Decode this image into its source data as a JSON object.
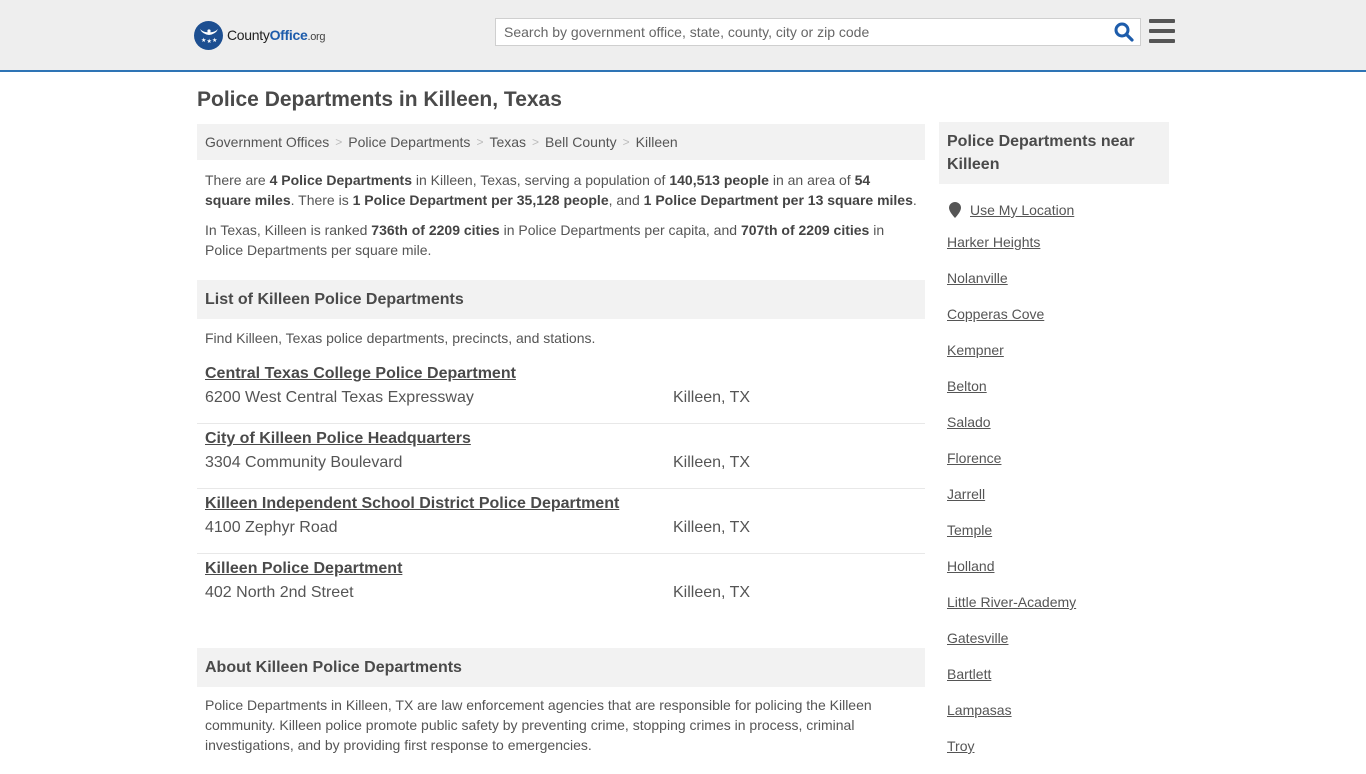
{
  "header": {
    "logo": {
      "name_main": "County",
      "name_accent": "Office",
      "name_tld": ".org"
    },
    "search": {
      "placeholder": "Search by government office, state, county, city or zip code",
      "value": ""
    },
    "icons": {
      "search": "search-icon",
      "menu": "hamburger-menu-icon"
    },
    "colors": {
      "accent": "#2e74b5",
      "logo_blue": "#1d4f91"
    }
  },
  "page": {
    "title": "Police Departments in Killeen, Texas"
  },
  "breadcrumb": [
    {
      "label": "Government Offices"
    },
    {
      "label": "Police Departments"
    },
    {
      "label": "Texas"
    },
    {
      "label": "Bell County"
    },
    {
      "label": "Killeen"
    }
  ],
  "summary": {
    "p1": {
      "t1": "There are ",
      "b1": "4 Police Departments",
      "t2": " in Killeen, Texas, serving a population of ",
      "b2": "140,513 people",
      "t3": " in an area of ",
      "b3": "54 square miles",
      "t4": ". There is ",
      "b4": "1 Police Department per 35,128 people",
      "t5": ", and ",
      "b5": "1 Police Department per 13 square miles",
      "t6": "."
    },
    "p2": {
      "t1": "In Texas, Killeen is ranked ",
      "b1": "736th of 2209 cities",
      "t2": " in Police Departments per capita, and ",
      "b2": "707th of 2209 cities",
      "t3": " in Police Departments per square mile."
    }
  },
  "list_section": {
    "heading": "List of Killeen Police Departments",
    "intro": "Find Killeen, Texas police departments, precincts, and stations.",
    "items": [
      {
        "name": "Central Texas College Police Department",
        "address": "6200 West Central Texas Expressway",
        "city": "Killeen, TX"
      },
      {
        "name": "City of Killeen Police Headquarters",
        "address": "3304 Community Boulevard",
        "city": "Killeen, TX"
      },
      {
        "name": "Killeen Independent School District Police Department",
        "address": "4100 Zephyr Road",
        "city": "Killeen, TX"
      },
      {
        "name": "Killeen Police Department",
        "address": "402 North 2nd Street",
        "city": "Killeen, TX"
      }
    ]
  },
  "about": {
    "heading": "About Killeen Police Departments",
    "text": "Police Departments in Killeen, TX are law enforcement agencies that are responsible for policing the Killeen community. Killeen police promote public safety by preventing crime, stopping crimes in process, criminal investigations, and by providing first response to emergencies."
  },
  "sidebar": {
    "heading": "Police Departments near Killeen",
    "use_location": "Use My Location",
    "nearby": [
      "Harker Heights",
      "Nolanville",
      "Copperas Cove",
      "Kempner",
      "Belton",
      "Salado",
      "Florence",
      "Jarrell",
      "Temple",
      "Holland",
      "Little River-Academy",
      "Gatesville",
      "Bartlett",
      "Lampasas",
      "Troy"
    ]
  }
}
